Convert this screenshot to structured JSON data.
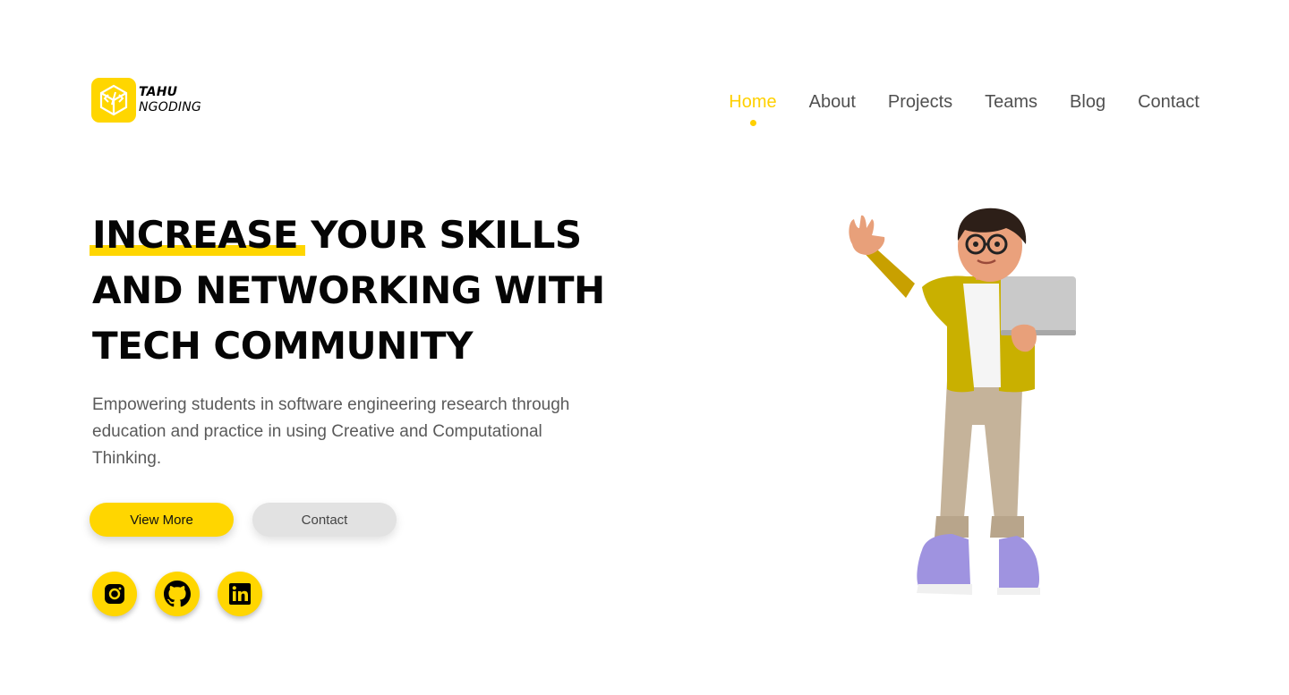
{
  "brand": {
    "name_top": "TAHU",
    "name_bottom": "NGODING",
    "logo_icon": "code-cube-icon",
    "accent_color": "#ffd600"
  },
  "nav": {
    "items": [
      {
        "label": "Home",
        "active": true
      },
      {
        "label": "About",
        "active": false
      },
      {
        "label": "Projects",
        "active": false
      },
      {
        "label": "Teams",
        "active": false
      },
      {
        "label": "Blog",
        "active": false
      },
      {
        "label": "Contact",
        "active": false
      }
    ]
  },
  "hero": {
    "title_highlight": "INCREASE",
    "title_line1_rest": " YOUR SKILLS",
    "title_line2": "AND NETWORKING WITH",
    "title_line3": "TECH COMMUNITY",
    "description": "Empowering students in software engineering research through education and practice in using Creative and Computational Thinking.",
    "primary_button": "View More",
    "secondary_button": "Contact"
  },
  "social": [
    {
      "icon": "instagram-icon"
    },
    {
      "icon": "github-icon"
    },
    {
      "icon": "linkedin-icon"
    }
  ],
  "illustration": {
    "icon": "character-with-laptop-illustration"
  }
}
